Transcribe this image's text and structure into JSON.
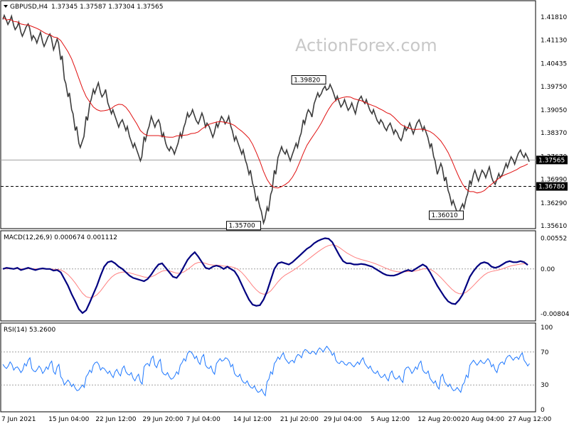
{
  "chart_data": [
    {
      "type": "line",
      "panel": "price",
      "symbol_label": "GBPUSD,H4",
      "ohlc_label": "1.37345 1.37587 1.37304 1.37565",
      "watermark": "ActionForex.com",
      "y_ticks": [
        "1.41810",
        "1.41130",
        "1.40435",
        "1.39750",
        "1.39050",
        "1.38370",
        "1.37670",
        "1.36990",
        "1.36290",
        "1.35610"
      ],
      "ylim": [
        1.3561,
        1.4215
      ],
      "current_price_label": "1.37565",
      "current_price": 1.37565,
      "support_label": "1.36780",
      "support_level": 1.3678,
      "annotations": [
        {
          "text": "1.35700",
          "value": 1.357,
          "index": 72
        },
        {
          "text": "1.39820",
          "value": 1.3982,
          "index": 90
        },
        {
          "text": "1.36010",
          "value": 1.3601,
          "index": 128
        }
      ],
      "colors": {
        "price": "#3c3c3c",
        "ma": "#e01010",
        "current_line": "#a0a0a0",
        "support_line": "#000000"
      },
      "x_tick_labels": [
        "7 Jun 2021",
        "15 Jun 04:00",
        "22 Jun 12:00",
        "29 Jun 20:00",
        "7 Jul 04:00",
        "14 Jul 12:00",
        "21 Jul 20:00",
        "29 Jul 04:00",
        "5 Aug 12:00",
        "12 Aug 20:00",
        "20 Aug 04:00",
        "27 Aug 12:00"
      ],
      "x_tick_index": [
        0,
        13,
        26,
        39,
        51,
        64,
        77,
        89,
        102,
        115,
        127,
        140
      ],
      "price_series": [
        1.418,
        1.4165,
        1.4178,
        1.415,
        1.416,
        1.413,
        1.4145,
        1.4155,
        1.412,
        1.411,
        1.413,
        1.41,
        1.4115,
        1.4125,
        1.409,
        1.411,
        1.406,
        1.399,
        1.395,
        1.39,
        1.385,
        1.38,
        1.382,
        1.388,
        1.393,
        1.396,
        1.398,
        1.395,
        1.396,
        1.392,
        1.39,
        1.388,
        1.386,
        1.387,
        1.385,
        1.382,
        1.38,
        1.378,
        1.376,
        1.382,
        1.385,
        1.388,
        1.386,
        1.387,
        1.383,
        1.38,
        1.379,
        1.378,
        1.38,
        1.383,
        1.386,
        1.389,
        1.39,
        1.388,
        1.387,
        1.389,
        1.386,
        1.385,
        1.383,
        1.386,
        1.388,
        1.387,
        1.388,
        1.385,
        1.382,
        1.38,
        1.378,
        1.375,
        1.372,
        1.368,
        1.364,
        1.361,
        1.3575,
        1.361,
        1.366,
        1.372,
        1.377,
        1.379,
        1.378,
        1.376,
        1.378,
        1.38,
        1.383,
        1.387,
        1.39,
        1.389,
        1.393,
        1.395,
        1.396,
        1.397,
        1.3975,
        1.396,
        1.394,
        1.392,
        1.393,
        1.391,
        1.392,
        1.39,
        1.393,
        1.394,
        1.393,
        1.391,
        1.39,
        1.388,
        1.387,
        1.386,
        1.385,
        1.386,
        1.384,
        1.383,
        1.382,
        1.385,
        1.386,
        1.384,
        1.386,
        1.387,
        1.385,
        1.383,
        1.38,
        1.376,
        1.372,
        1.374,
        1.37,
        1.366,
        1.363,
        1.361,
        1.3605,
        1.362,
        1.365,
        1.369,
        1.372,
        1.37,
        1.372,
        1.371,
        1.373,
        1.37,
        1.369,
        1.371,
        1.372,
        1.374,
        1.376,
        1.375,
        1.377,
        1.378,
        1.377,
        1.3757
      ]
    },
    {
      "type": "line",
      "panel": "macd",
      "header_label": "MACD(12,26,9) 0.000674 0.001112",
      "y_ticks": [
        "0.00552",
        "0.00",
        "-0.00804"
      ],
      "ylim": [
        -0.0088,
        0.0062
      ],
      "colors": {
        "macd": "#000080",
        "signal": "#ff8080",
        "zero_line": "#a0a0a0"
      },
      "macd_series": [
        0.0,
        0.0002,
        0.0001,
        0.0,
        0.0002,
        -0.0002,
        0.0,
        0.0002,
        0.0,
        -0.0002,
        0.0,
        0.0001,
        0.0,
        0.0,
        -0.0003,
        -0.0002,
        -0.0006,
        -0.0018,
        -0.003,
        -0.0045,
        -0.0058,
        -0.0072,
        -0.0079,
        -0.0074,
        -0.006,
        -0.0045,
        -0.003,
        -0.0012,
        0.0004,
        0.0012,
        0.0014,
        0.001,
        0.0004,
        0.0,
        -0.0006,
        -0.0012,
        -0.0016,
        -0.0018,
        -0.002,
        -0.0022,
        -0.0018,
        -0.001,
        0.0,
        0.0008,
        0.001,
        0.0002,
        -0.0006,
        -0.0014,
        -0.0016,
        -0.0008,
        0.0004,
        0.0016,
        0.0024,
        0.003,
        0.0022,
        0.0012,
        0.0002,
        0.0,
        0.0004,
        0.0006,
        0.0004,
        0.0,
        0.0004,
        0.0,
        -0.0004,
        -0.0014,
        -0.0028,
        -0.0042,
        -0.0055,
        -0.0064,
        -0.0066,
        -0.0065,
        -0.0055,
        -0.004,
        -0.002,
        0.0,
        0.001,
        0.0012,
        0.001,
        0.0008,
        0.0012,
        0.0018,
        0.0024,
        0.003,
        0.0036,
        0.004,
        0.0046,
        0.005,
        0.0053,
        0.0055,
        0.0054,
        0.0048,
        0.0036,
        0.0024,
        0.0014,
        0.001,
        0.001,
        0.0008,
        0.0008,
        0.0009,
        0.0008,
        0.0006,
        0.0004,
        0.0,
        -0.0004,
        -0.0008,
        -0.0011,
        -0.0012,
        -0.0012,
        -0.001,
        -0.0007,
        -0.0004,
        -0.0002,
        -0.0004,
        0.0,
        0.0004,
        0.0008,
        0.0004,
        -0.0006,
        -0.0018,
        -0.003,
        -0.004,
        -0.005,
        -0.0058,
        -0.0062,
        -0.0063,
        -0.0056,
        -0.0046,
        -0.003,
        -0.0014,
        -0.0004,
        0.0004,
        0.001,
        0.0012,
        0.001,
        0.0004,
        0.0002,
        0.0004,
        0.0008,
        0.0012,
        0.0014,
        0.0012,
        0.0012,
        0.0014,
        0.0012,
        0.0007
      ]
    },
    {
      "type": "line",
      "panel": "rsi",
      "header_label": "RSI(14) 53.2600",
      "y_ticks": [
        "100",
        "70",
        "30",
        "0"
      ],
      "ylim": [
        0,
        100
      ],
      "levels": [
        70,
        30
      ],
      "colors": {
        "rsi": "#1e78ff",
        "level_line": "#a0a0a0"
      },
      "rsi_series": [
        55,
        50,
        58,
        48,
        52,
        45,
        56,
        60,
        50,
        46,
        53,
        44,
        52,
        56,
        46,
        52,
        40,
        30,
        36,
        28,
        26,
        24,
        30,
        40,
        48,
        54,
        58,
        48,
        50,
        44,
        42,
        46,
        44,
        50,
        46,
        42,
        38,
        40,
        34,
        52,
        56,
        62,
        54,
        58,
        46,
        42,
        40,
        38,
        46,
        54,
        62,
        68,
        70,
        62,
        58,
        64,
        54,
        50,
        46,
        56,
        62,
        60,
        62,
        52,
        44,
        40,
        36,
        32,
        30,
        26,
        24,
        22,
        20,
        34,
        46,
        56,
        64,
        66,
        62,
        56,
        60,
        64,
        66,
        70,
        72,
        68,
        70,
        72,
        73,
        74,
        74,
        66,
        60,
        56,
        58,
        54,
        57,
        52,
        58,
        60,
        56,
        50,
        48,
        44,
        42,
        40,
        38,
        44,
        40,
        38,
        36,
        48,
        52,
        44,
        52,
        56,
        48,
        44,
        38,
        32,
        28,
        40,
        34,
        28,
        26,
        24,
        24,
        30,
        42,
        54,
        60,
        54,
        60,
        56,
        62,
        52,
        48,
        54,
        58,
        62,
        66,
        60,
        64,
        66,
        60,
        53
      ]
    }
  ]
}
